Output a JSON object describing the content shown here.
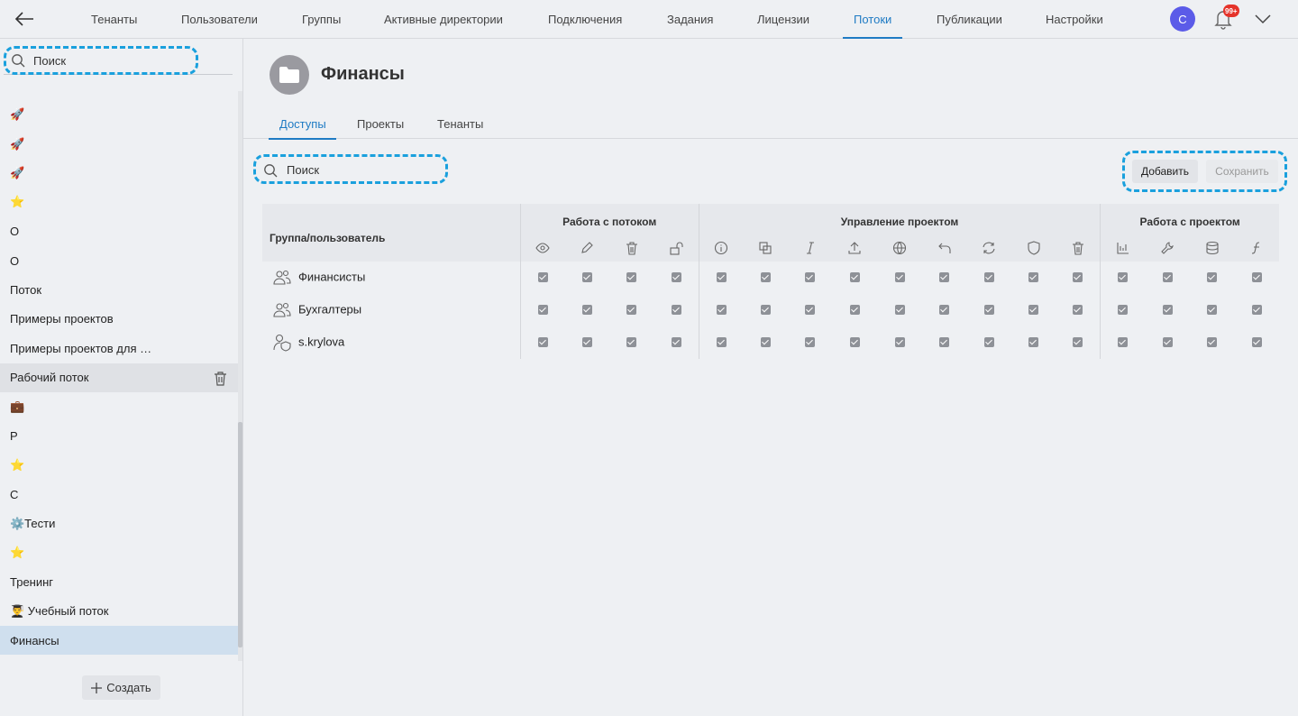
{
  "app": {
    "nav": [
      "Тенанты",
      "Пользователи",
      "Группы",
      "Активные директории",
      "Подключения",
      "Задания",
      "Лицензии",
      "Потоки",
      "Публикации",
      "Настройки"
    ],
    "active_nav": "Потоки",
    "avatar_letter": "С",
    "notifications": "99+"
  },
  "sidebar": {
    "search_placeholder": "Поиск",
    "items": [
      {
        "label": "🚀"
      },
      {
        "label": "🚀"
      },
      {
        "label": "🚀"
      },
      {
        "label": "⭐"
      },
      {
        "label": "О"
      },
      {
        "label": "О"
      },
      {
        "label": "Поток"
      },
      {
        "label": "Примеры проектов"
      },
      {
        "label": "Примеры проектов для …"
      },
      {
        "label": "Рабочий поток"
      },
      {
        "label": "💼"
      },
      {
        "label": "Р"
      },
      {
        "label": "⭐"
      },
      {
        "label": "С"
      },
      {
        "label": "⚙️Тести"
      },
      {
        "label": "⭐"
      },
      {
        "label": "Тренинг"
      },
      {
        "label": "👨‍🎓 Учебный поток"
      },
      {
        "label": "Финансы"
      }
    ],
    "hovered_item": "Рабочий поток",
    "selected_item": "Финансы",
    "create_label": "Создать"
  },
  "page": {
    "title": "Финансы",
    "tabs": [
      "Доступы",
      "Проекты",
      "Тенанты"
    ],
    "active_tab": "Доступы",
    "search_placeholder": "Поиск",
    "add_label": "Добавить",
    "save_label": "Сохранить"
  },
  "table": {
    "first_col_header": "Группа/пользователь",
    "groups": [
      {
        "label": "Работа с потоком",
        "icons": [
          "eye-icon",
          "pencil-icon",
          "trash-icon",
          "unlock-icon"
        ]
      },
      {
        "label": "Управление проектом",
        "icons": [
          "info-icon",
          "copy-icon",
          "italic-icon",
          "upload-icon",
          "globe-icon",
          "undo-icon",
          "sync-icon",
          "shield-icon",
          "trash-icon"
        ]
      },
      {
        "label": "Работа с проектом",
        "icons": [
          "chart-icon",
          "wrench-icon",
          "database-icon",
          "function-icon"
        ]
      }
    ],
    "rows": [
      {
        "name": "Финансисты",
        "kind": "group",
        "checked": [
          true,
          true,
          true,
          true,
          true,
          true,
          true,
          true,
          true,
          true,
          true,
          true,
          true,
          true,
          true,
          true,
          true
        ]
      },
      {
        "name": "Бухгалтеры",
        "kind": "group",
        "checked": [
          true,
          true,
          true,
          true,
          true,
          true,
          true,
          true,
          true,
          true,
          true,
          true,
          true,
          true,
          true,
          true,
          true
        ]
      },
      {
        "name": "s.krylova",
        "kind": "user",
        "checked": [
          true,
          true,
          true,
          true,
          true,
          true,
          true,
          true,
          true,
          true,
          true,
          true,
          true,
          true,
          true,
          true,
          true
        ]
      }
    ]
  }
}
